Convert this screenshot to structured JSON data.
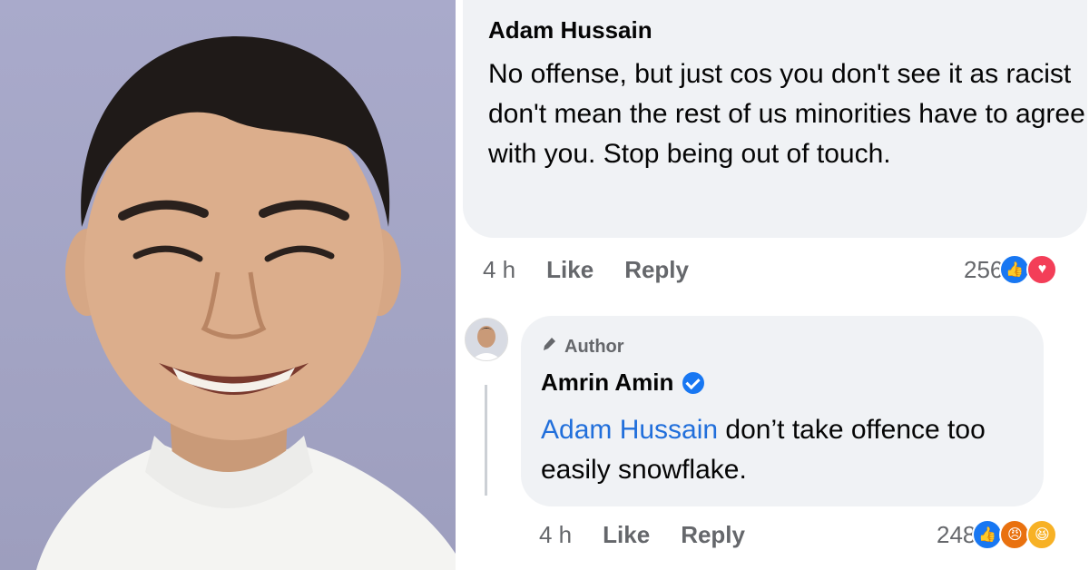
{
  "comment1": {
    "author": "Adam Hussain",
    "text": "No offense, but just cos you don't see it as racist don't mean the rest of us minorities have to agree with you. Stop being out of touch.",
    "time": "4 h",
    "like_label": "Like",
    "reply_label": "Reply",
    "reaction_count": "256",
    "reactions": [
      "like-icon",
      "love-icon"
    ]
  },
  "comment2": {
    "badge": "Author",
    "author": "Amrin Amin",
    "verified": true,
    "mention": "Adam Hussain",
    "text": " don’t take offence too easily snowflake.",
    "time": "4 h",
    "like_label": "Like",
    "reply_label": "Reply",
    "reaction_count": "248",
    "reactions": [
      "like-icon",
      "angry-icon",
      "haha-icon"
    ]
  },
  "colors": {
    "bubble_bg": "#f0f2f5",
    "mention": "#216fdb",
    "meta": "#65676b",
    "verified": "#1877f2"
  }
}
